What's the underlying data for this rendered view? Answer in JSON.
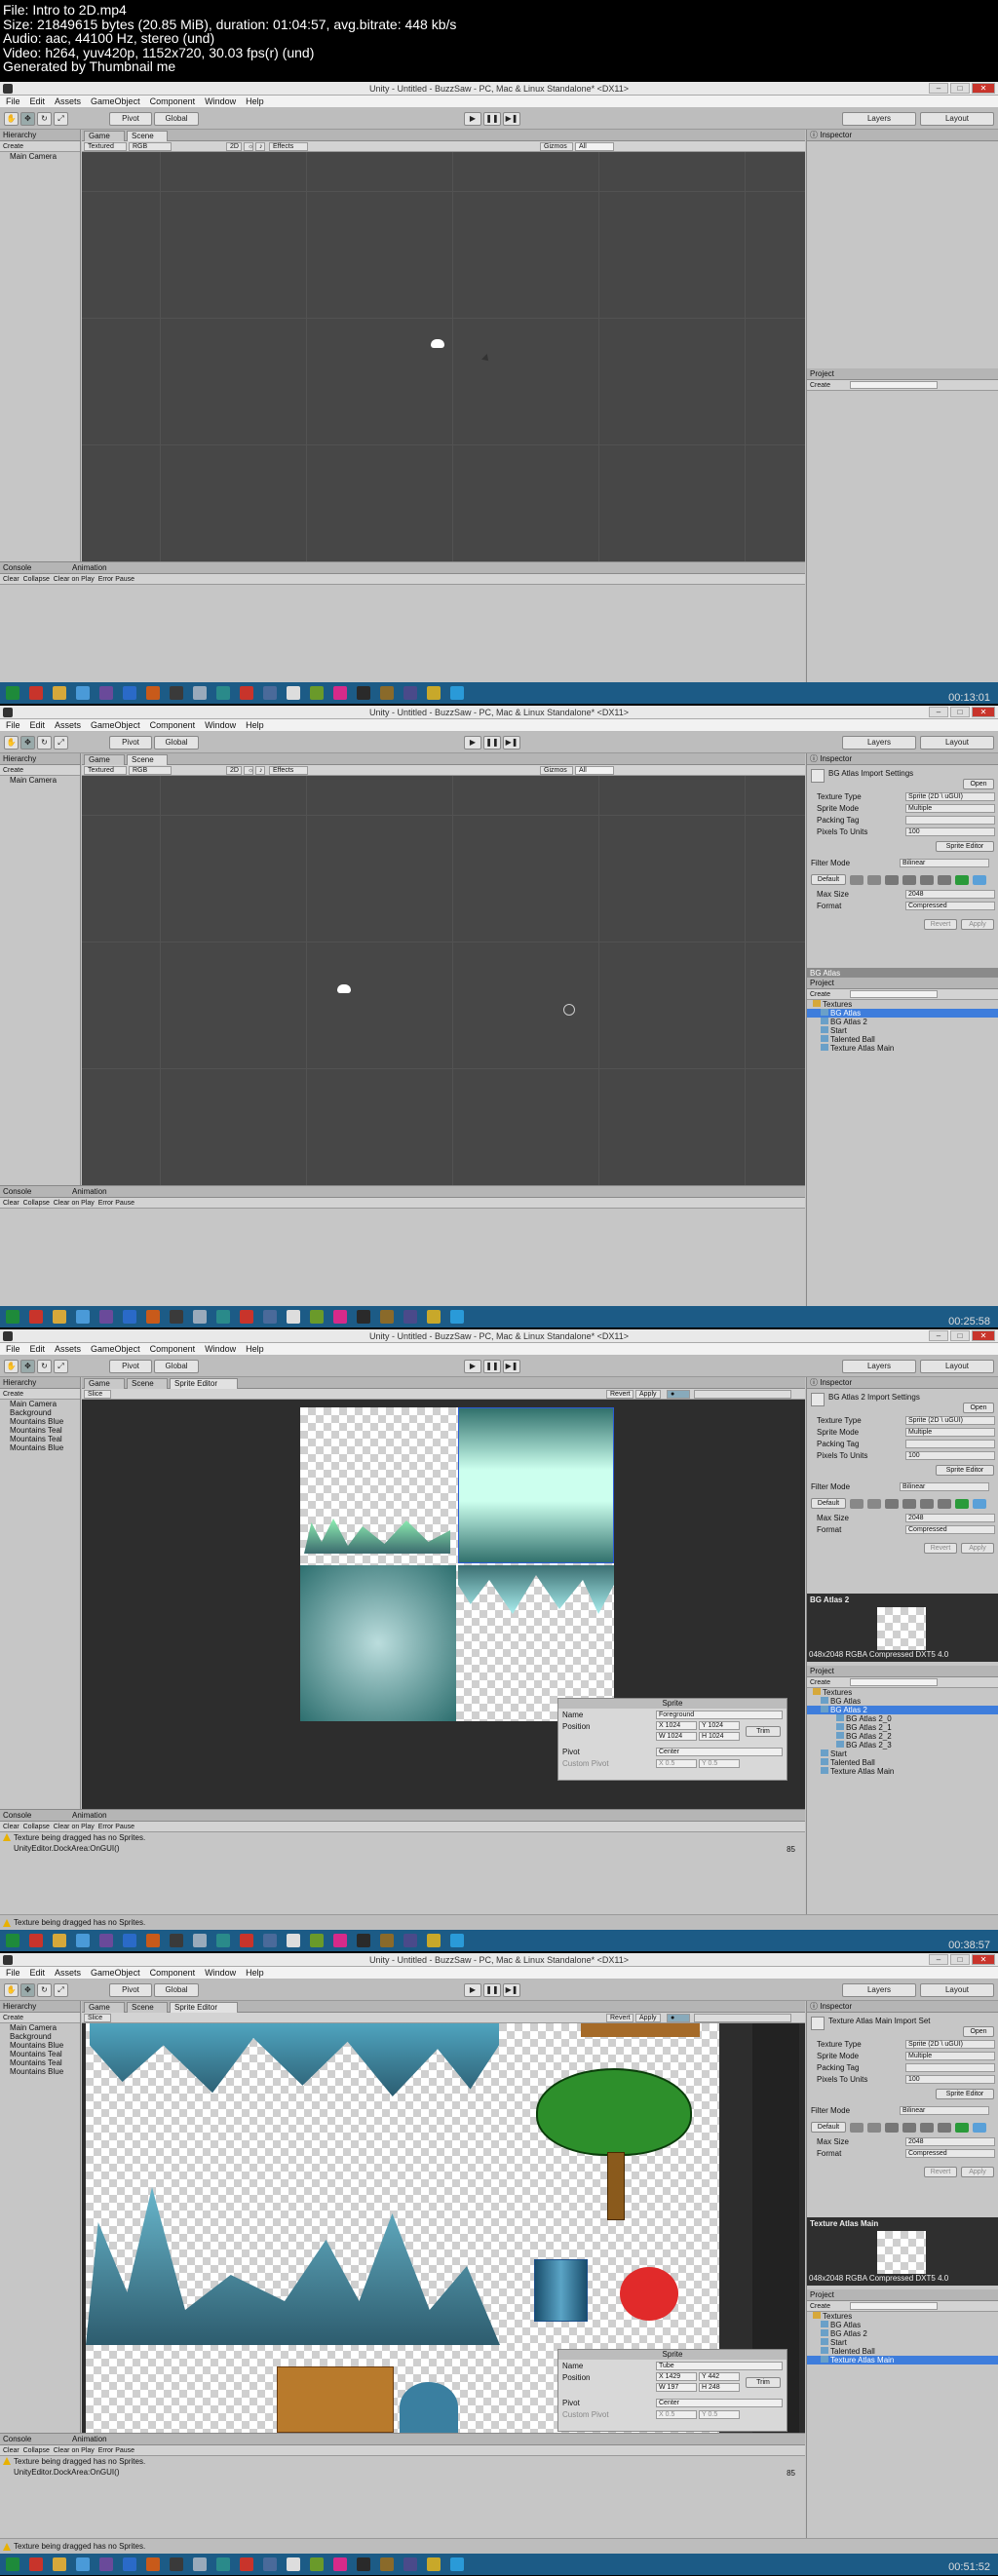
{
  "file_info": {
    "line1": "File: Intro to 2D.mp4",
    "line2": "Size: 21849615 bytes (20.85 MiB), duration: 01:04:57, avg.bitrate: 448 kb/s",
    "line3": "Audio: aac, 44100 Hz, stereo (und)",
    "line4": "Video: h264, yuv420p, 1152x720, 30.03 fps(r) (und)",
    "line5": "Generated by Thumbnail me"
  },
  "window_title": "Unity - Untitled - BuzzSaw - PC, Mac & Linux Standalone* <DX11>",
  "menu": [
    "File",
    "Edit",
    "Assets",
    "GameObject",
    "Component",
    "Window",
    "Help"
  ],
  "toolbar": {
    "pivot": "Pivot",
    "global": "Global",
    "layers": "Layers",
    "layout": "Layout"
  },
  "hierarchy": {
    "title": "Hierarchy",
    "create": "Create"
  },
  "tabs": {
    "game": "Game",
    "scene": "Scene",
    "sprite_editor": "Sprite Editor"
  },
  "scene_bar": {
    "textured": "Textured",
    "rgb": "RGB",
    "mode_2d": "2D",
    "effects": "Effects",
    "gizmos": "Gizmos",
    "all": "All"
  },
  "inspector": {
    "title": "Inspector",
    "open": "Open",
    "texture_type": "Texture Type",
    "texture_type_val": "Sprite (2D \\ uGUI)",
    "sprite_mode": "Sprite Mode",
    "sprite_mode_val": "Multiple",
    "packing_tag": "Packing Tag",
    "pixels_to_units": "Pixels To Units",
    "pixels_to_units_val": "100",
    "sprite_editor_btn": "Sprite Editor",
    "filter_mode": "Filter Mode",
    "filter_mode_val": "Bilinear",
    "default": "Default",
    "max_size": "Max Size",
    "max_size_val": "2048",
    "format": "Format",
    "format_val": "Compressed",
    "revert": "Revert",
    "apply": "Apply"
  },
  "project": {
    "title": "Project",
    "create": "Create"
  },
  "console": {
    "title": "Console",
    "animation": "Animation",
    "clear": "Clear",
    "collapse": "Collapse",
    "clear_on_play": "Clear on Play",
    "error_pause": "Error Pause"
  },
  "frames": [
    {
      "timestamp": "",
      "hierarchy_items": [
        "Main Camera"
      ],
      "inspector_header": "",
      "project_items": [],
      "messages": [],
      "status": ""
    },
    {
      "timestamp": "00:13:01",
      "hierarchy_items": [
        "Main Camera"
      ],
      "inspector_header": "BG Atlas Import Settings",
      "asset_label": "BG Atlas",
      "project_items": [
        "Textures",
        "BG Atlas",
        "BG Atlas 2",
        "Start",
        "Talented Ball",
        "Texture Atlas Main"
      ],
      "messages": [],
      "status": ""
    },
    {
      "timestamp": "00:25:58",
      "hierarchy_items": [
        "Main Camera",
        "Background",
        "Mountains Blue",
        "Mountains Teal",
        "Mountains Teal",
        "Mountains Blue"
      ],
      "inspector_header": "BG Atlas 2 Import Settings",
      "asset_label": "BG Atlas 2",
      "preview_text": "048x2048  RGBA Compressed DXT5   4.0",
      "project_items": [
        "Textures",
        "BG Atlas",
        "BG Atlas 2",
        "BG Atlas 2_0",
        "BG Atlas 2_1",
        "BG Atlas 2_2",
        "BG Atlas 2_3",
        "Start",
        "Talented Ball",
        "Texture Atlas Main"
      ],
      "messages": [
        "Texture being dragged has no Sprites.",
        "UnityEditor.DockArea:OnGUI()"
      ],
      "msg_count": "85",
      "status": "Texture being dragged has no Sprites.",
      "sprite": {
        "header": "Sprite",
        "name_label": "Name",
        "name": "Foreground",
        "position_label": "Position",
        "x": "X 1024",
        "y": "Y 1024",
        "w": "W 1024",
        "h": "H 1024",
        "trim": "Trim",
        "pivot_label": "Pivot",
        "pivot": "Center",
        "custom_pivot": "Custom Pivot",
        "cx": "X 0.5",
        "cy": "Y 0.5"
      }
    },
    {
      "timestamp": "00:38:57",
      "hierarchy_items": [
        "Main Camera",
        "Background",
        "Mountains Blue",
        "Mountains Teal",
        "Mountains Teal",
        "Mountains Blue"
      ],
      "inspector_header": "Texture Atlas Main Import Set",
      "asset_label": "Texture Atlas Main",
      "preview_text": "048x2048  RGBA Compressed DXT5   4.0",
      "project_items": [
        "Textures",
        "BG Atlas",
        "BG Atlas 2",
        "Start",
        "Talented Ball",
        "Texture Atlas Main"
      ],
      "messages": [
        "Texture being dragged has no Sprites.",
        "UnityEditor.DockArea:OnGUI()"
      ],
      "msg_count": "85",
      "status": "Texture being dragged has no Sprites.",
      "sprite": {
        "header": "Sprite",
        "name_label": "Name",
        "name": "Tube",
        "position_label": "Position",
        "x": "X 1429",
        "y": "Y 442",
        "w": "W 197",
        "h": "H 248",
        "trim": "Trim",
        "pivot_label": "Pivot",
        "pivot": "Center",
        "custom_pivot": "Custom Pivot",
        "cx": "X 0.5",
        "cy": "Y 0.5"
      }
    }
  ],
  "sprite_editor_bar": {
    "slice": "Slice",
    "revert": "Revert",
    "apply": "Apply"
  },
  "extra_timestamp": "00:51:52",
  "colors": {
    "accent": "#3e7ddc",
    "taskbar": "#1c5b86",
    "scene_bg": "#474747"
  }
}
